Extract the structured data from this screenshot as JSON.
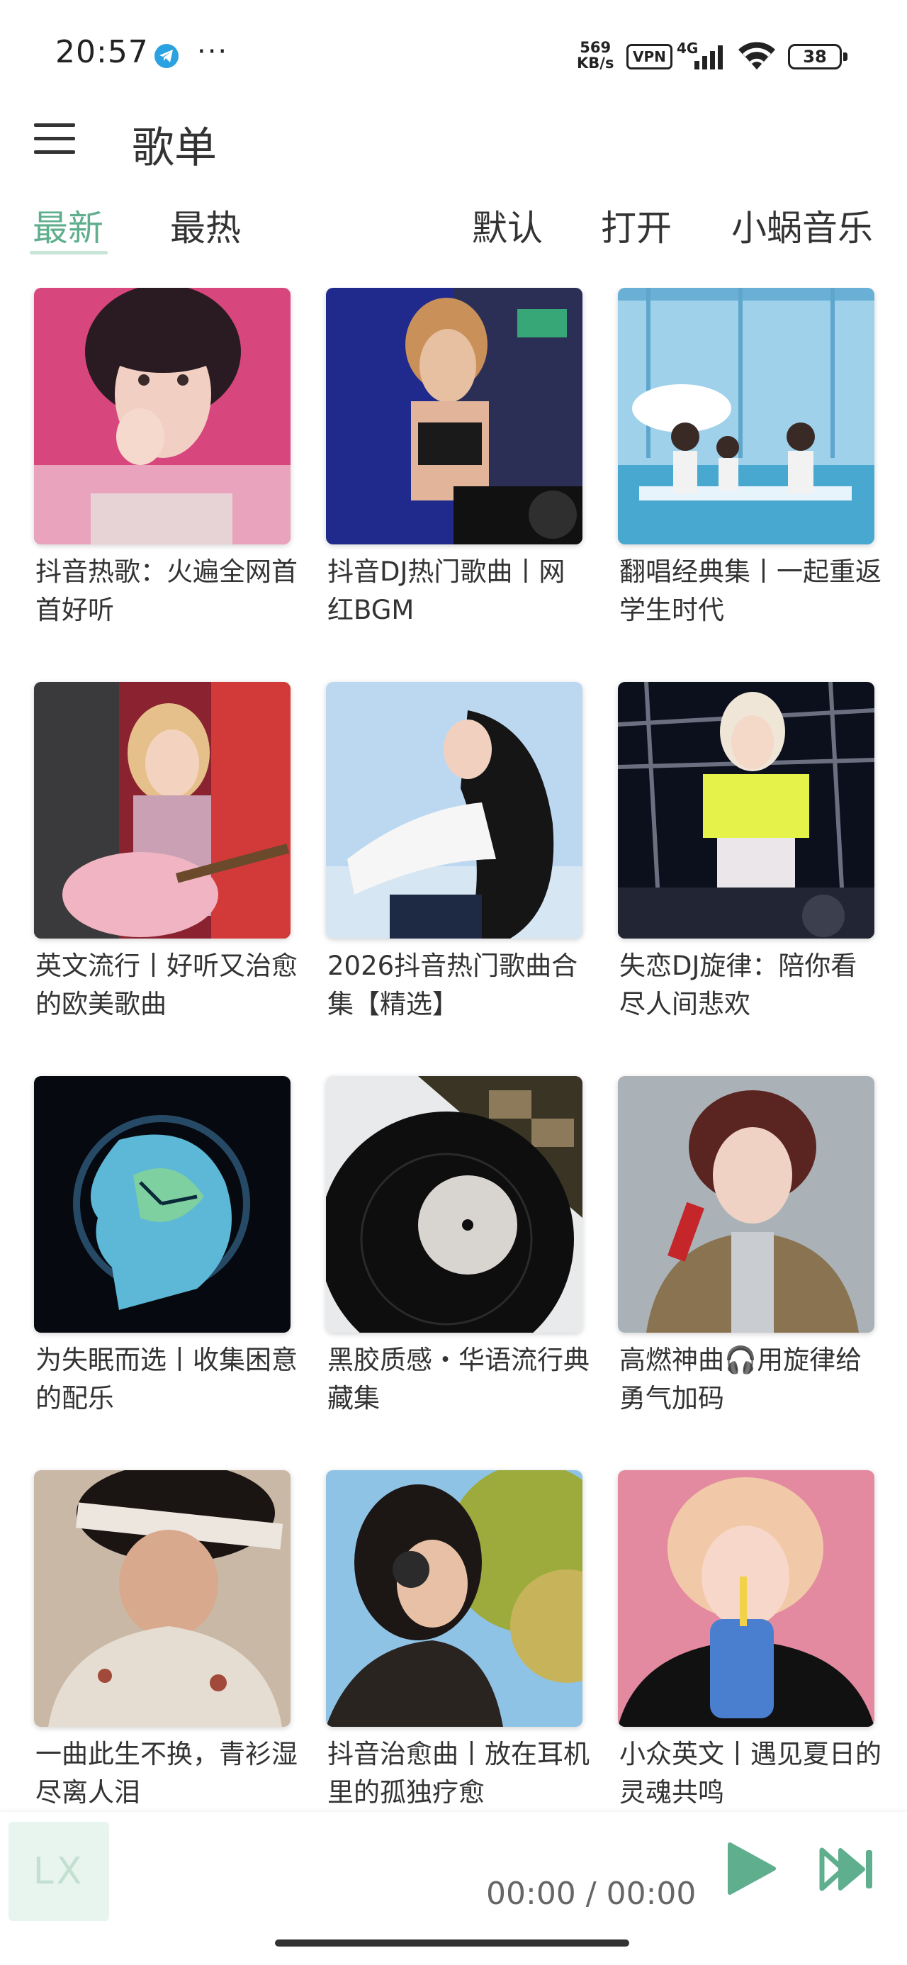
{
  "status_bar": {
    "time": "20:57",
    "more": "···",
    "net_speed_value": "569",
    "net_speed_unit": "KB/s",
    "vpn": "VPN",
    "network": "4G",
    "battery": "38"
  },
  "header": {
    "title": "歌单"
  },
  "tabs": {
    "left": [
      "最新",
      "最热"
    ],
    "right": [
      "默认",
      "打开",
      "小蜗音乐"
    ],
    "active_color": "#5fae8e"
  },
  "playlists": [
    {
      "title": "抖音热歌：火遍全网首首好听"
    },
    {
      "title": "抖音DJ热门歌曲丨网红BGM"
    },
    {
      "title": "翻唱经典集丨一起重返学生时代"
    },
    {
      "title": "英文流行丨好听又治愈的欧美歌曲"
    },
    {
      "title": "2026抖音热门歌曲合集【精选】"
    },
    {
      "title": "失恋DJ旋律：陪你看尽人间悲欢"
    },
    {
      "title": "为失眠而选丨收集困意的配乐"
    },
    {
      "title": "黑胶质感・华语流行典藏集"
    },
    {
      "title": "高燃神曲🎧用旋律给勇气加码"
    },
    {
      "title": "一曲此生不换，青衫湿尽离人泪"
    },
    {
      "title": "抖音治愈曲丨放在耳机里的孤独疗愈"
    },
    {
      "title": "小众英文丨遇见夏日的灵魂共鸣"
    }
  ],
  "player": {
    "art_label": "LX",
    "time": "00:00 / 00:00",
    "accent_color": "#5fae8e"
  },
  "icons": [
    "menu-icon",
    "telegram-icon",
    "signal-icon",
    "wifi-icon",
    "battery-icon",
    "play-icon",
    "next-icon"
  ]
}
